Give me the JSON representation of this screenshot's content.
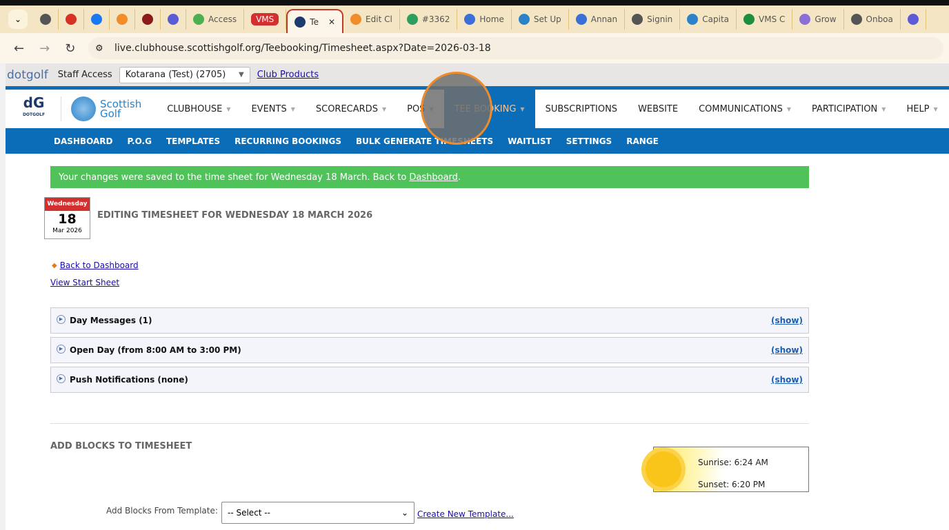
{
  "browser": {
    "tabs": [
      {
        "label": "",
        "icon": "globe-icon",
        "color": "#555"
      },
      {
        "label": "",
        "icon": "gmail-icon",
        "color": "#d93025"
      },
      {
        "label": "",
        "icon": "facebook-icon",
        "color": "#1877f2"
      },
      {
        "label": "",
        "icon": "a-logo-icon",
        "color": "#f28c28"
      },
      {
        "label": "",
        "icon": "crest-icon",
        "color": "#8b1a1a"
      },
      {
        "label": "",
        "icon": "stripe-logo-icon",
        "color": "#5b5bd6"
      },
      {
        "label": "Access",
        "icon": "leaf-icon",
        "color": "#4caf50"
      },
      {
        "label": "VMS",
        "icon": "vms-badge",
        "color": "#d32f2f"
      },
      {
        "label": "Te",
        "icon": "dotgolf-icon",
        "color": "#1c3a6b",
        "active": true
      },
      {
        "label": "Edit Cl",
        "icon": "a-logo-icon",
        "color": "#f28c28"
      },
      {
        "label": "#3362",
        "icon": "ticket-icon",
        "color": "#2e9e5e"
      },
      {
        "label": "Home",
        "icon": "ring-icon",
        "color": "#3a6fd8"
      },
      {
        "label": "Set Up",
        "icon": "saltire-icon",
        "color": "#2b82c9"
      },
      {
        "label": "Annan",
        "icon": "ring-icon",
        "color": "#3a6fd8"
      },
      {
        "label": "Signin",
        "icon": "globe-icon",
        "color": "#555"
      },
      {
        "label": "Capita",
        "icon": "saltire-icon",
        "color": "#2b82c9"
      },
      {
        "label": "VMS C",
        "icon": "sheets-icon",
        "color": "#1e8e3e"
      },
      {
        "label": "Grow",
        "icon": "flower-icon",
        "color": "#8a6fd8"
      },
      {
        "label": "Onboa",
        "icon": "globe-icon",
        "color": "#555"
      },
      {
        "label": "",
        "icon": "stripe-logo-icon",
        "color": "#5b5bd6"
      }
    ],
    "close_glyph": "✕",
    "url": "live.clubhouse.scottishgolf.org/Teebooking/Timesheet.aspx?Date=2026-03-18"
  },
  "staffbar": {
    "brand": "dotgolf",
    "label": "Staff Access",
    "club_select": "Kotarana (Test) (2705)",
    "club_products": "Club Products"
  },
  "nav": {
    "logo_text": "DOTGOLF",
    "logo_mark": "dG",
    "sg_line1": "Scottish",
    "sg_line2": "Golf",
    "items": [
      "CLUBHOUSE",
      "EVENTS",
      "SCORECARDS",
      "POS",
      "TEE BOOKING",
      "SUBSCRIPTIONS",
      "WEBSITE",
      "COMMUNICATIONS",
      "PARTICIPATION",
      "HELP"
    ],
    "subitems": [
      "DASHBOARD",
      "P.O.G",
      "TEMPLATES",
      "RECURRING BOOKINGS",
      "BULK GENERATE TIMESHEETS",
      "WAITLIST",
      "SETTINGS",
      "RANGE"
    ]
  },
  "alert": {
    "text": "Your changes were saved to the time sheet for Wednesday 18 March. Back to",
    "link": "Dashboard",
    "end": "."
  },
  "calendar": {
    "dow": "Wednesday",
    "day": "18",
    "month_year": "Mar 2026"
  },
  "page_title": "EDITING TIMESHEET FOR WEDNESDAY 18 MARCH 2026",
  "links": {
    "back": "Back to Dashboard",
    "start_sheet": "View Start Sheet"
  },
  "panels": [
    {
      "title": "Day Messages (1)",
      "toggle": "(show)"
    },
    {
      "title": "Open Day (from 8:00 AM to 3:00 PM)",
      "toggle": "(show)"
    },
    {
      "title": "Push Notifications (none)",
      "toggle": "(show)"
    }
  ],
  "add_blocks": {
    "heading": "ADD BLOCKS TO TIMESHEET",
    "template_label": "Add Blocks From Template:",
    "template_select": "-- Select --",
    "create_link": "Create New Template..."
  },
  "sun": {
    "sunrise": "Sunrise: 6:24 AM",
    "sunset": "Sunset: 6:20 PM"
  }
}
